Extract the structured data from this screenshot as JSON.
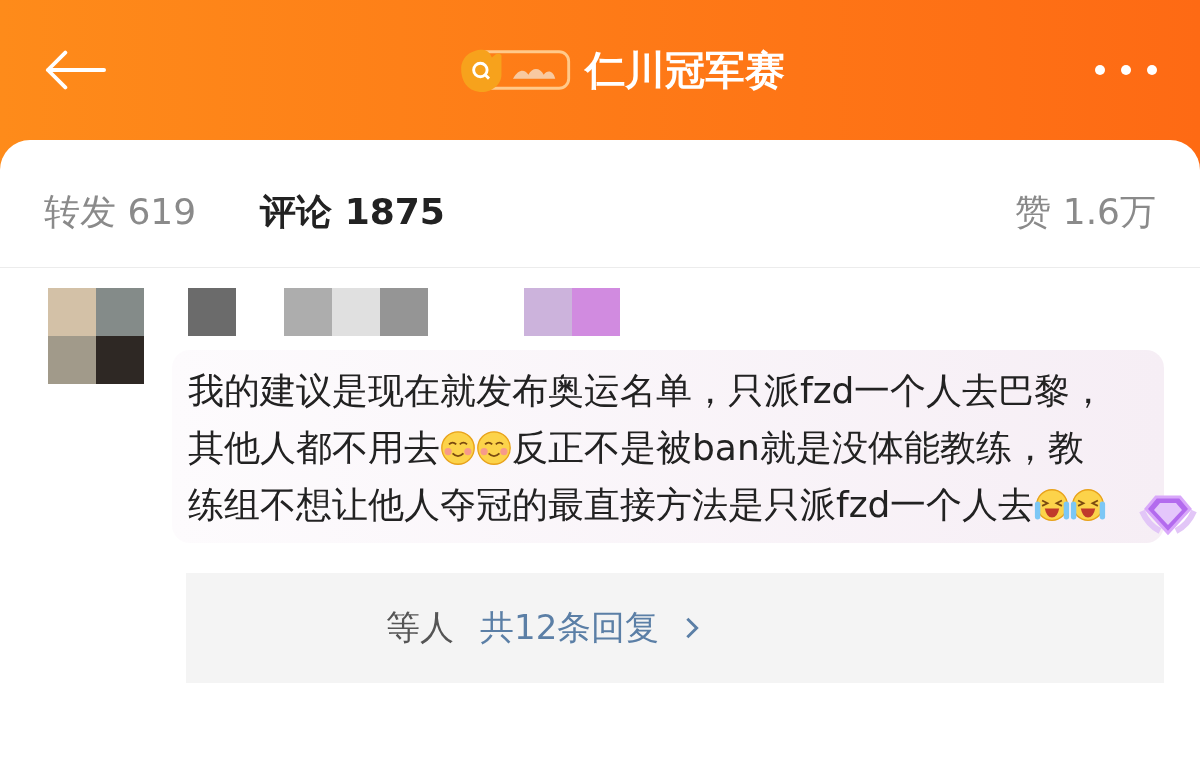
{
  "header": {
    "title": "仁川冠军赛"
  },
  "tabs": [
    {
      "label": "转发",
      "count": "619",
      "selected": false
    },
    {
      "label": "评论",
      "count": "1875",
      "selected": true
    }
  ],
  "likes": {
    "label": "赞",
    "count": "1.6万"
  },
  "comment": {
    "segments": [
      {
        "kind": "text",
        "text": "我的建议是现在就发布奥运名单，只派fzd一个人去巴黎，其他人都不用去"
      },
      {
        "kind": "blush"
      },
      {
        "kind": "blush"
      },
      {
        "kind": "text",
        "text": "反正不是被ban就是没体能教练，教练组不想让他人夺冠的最直接方法是只派fzd一个人去"
      },
      {
        "kind": "laugh"
      },
      {
        "kind": "laugh"
      }
    ]
  },
  "replies": {
    "who": "等人",
    "link": "共12条回复"
  }
}
